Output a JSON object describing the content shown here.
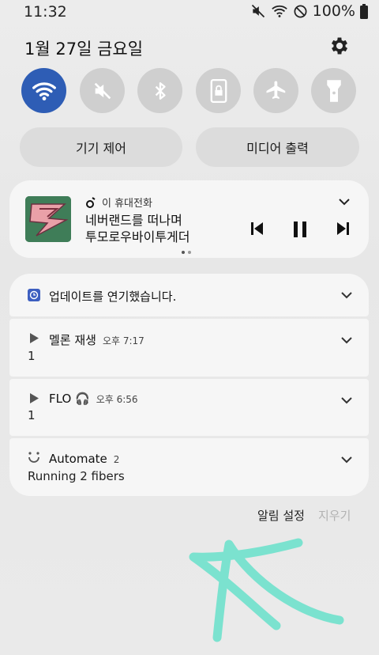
{
  "status_bar": {
    "time": "11:32",
    "battery": "100%"
  },
  "header": {
    "date": "1월 27일 금요일"
  },
  "quick_toggles": [
    {
      "name": "wifi",
      "active": true
    },
    {
      "name": "mute",
      "active": false
    },
    {
      "name": "bluetooth",
      "active": false
    },
    {
      "name": "screen-lock",
      "active": false
    },
    {
      "name": "airplane-mode",
      "active": false
    },
    {
      "name": "flashlight",
      "active": false
    }
  ],
  "pills": {
    "device_control": "기기 제어",
    "media_output": "미디어 출력"
  },
  "media": {
    "source": "이 휴대전화",
    "title_line1": "네버랜드를 떠나며",
    "title_line2": "투모로우바이투게더",
    "page_count": 2,
    "current_page": 1
  },
  "notifications": [
    {
      "app": "업데이트를 연기했습니다.",
      "time": "",
      "body": ""
    },
    {
      "app": "멜론 재생",
      "time": "오후 7:17",
      "body": "1"
    },
    {
      "app": "FLO 🎧",
      "time": "오후 6:56",
      "body": "1"
    },
    {
      "app": "Automate",
      "time": "2",
      "body": "Running 2 fibers"
    }
  ],
  "footer": {
    "settings": "알림 설정",
    "clear": "지우기"
  },
  "colors": {
    "accent": "#2e5db5",
    "toggle_off": "#cfcfcf",
    "card": "#f6f6f6",
    "scribble": "#5fe0c8"
  }
}
